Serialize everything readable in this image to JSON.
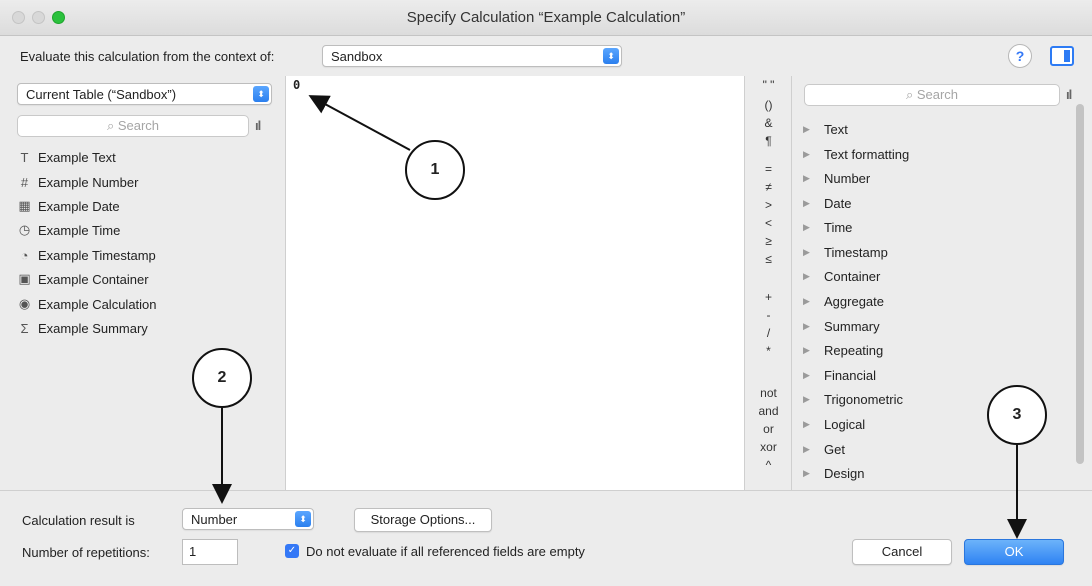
{
  "window": {
    "title": "Specify Calculation “Example Calculation”"
  },
  "context": {
    "label": "Evaluate this calculation from the context of:",
    "value": "Sandbox"
  },
  "left": {
    "table_select": "Current Table (“Sandbox”)",
    "search_placeholder": "Search",
    "fields": [
      {
        "icon": "T",
        "name": "Example Text"
      },
      {
        "icon": "#",
        "name": "Example Number"
      },
      {
        "icon": "▦",
        "name": "Example Date"
      },
      {
        "icon": "◷",
        "name": "Example Time"
      },
      {
        "icon": "◔",
        "name": "Example Timestamp"
      },
      {
        "icon": "▣",
        "name": "Example Container"
      },
      {
        "icon": "◉",
        "name": "Example Calculation"
      },
      {
        "icon": "Σ",
        "name": "Example Summary"
      }
    ]
  },
  "editor": {
    "text": "0"
  },
  "operators": [
    {
      "label": "\" \""
    },
    {
      "label": "()"
    },
    {
      "label": "&"
    },
    {
      "label": "¶"
    },
    {
      "label": "="
    },
    {
      "label": "≠"
    },
    {
      "label": ">"
    },
    {
      "label": "<"
    },
    {
      "label": "≥"
    },
    {
      "label": "≤"
    },
    {
      "label": "+"
    },
    {
      "label": "-"
    },
    {
      "label": "/"
    },
    {
      "label": "*"
    },
    {
      "label": "not"
    },
    {
      "label": "and"
    },
    {
      "label": "or"
    },
    {
      "label": "xor"
    },
    {
      "label": "^"
    }
  ],
  "right": {
    "search_placeholder": "Search",
    "functions": [
      "Text",
      "Text formatting",
      "Number",
      "Date",
      "Time",
      "Timestamp",
      "Container",
      "Aggregate",
      "Summary",
      "Repeating",
      "Financial",
      "Trigonometric",
      "Logical",
      "Get",
      "Design"
    ]
  },
  "bottom": {
    "result_label": "Calculation result is",
    "result_value": "Number",
    "storage_button": "Storage Options...",
    "repetitions_label": "Number of repetitions:",
    "repetitions_value": "1",
    "checkbox_label": "Do not evaluate if all referenced fields are empty",
    "cancel_button": "Cancel",
    "ok_button": "OK"
  },
  "callouts": [
    "1",
    "2",
    "3"
  ],
  "colors": {
    "accent": "#3478f6",
    "ok": "#2f83f3"
  }
}
